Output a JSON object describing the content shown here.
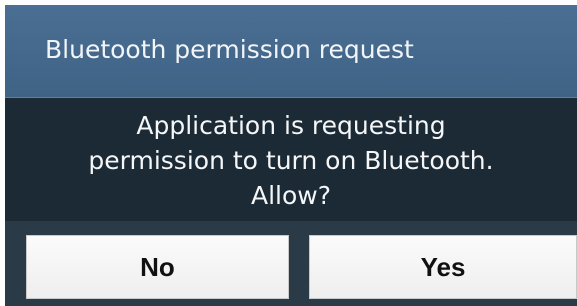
{
  "dialog": {
    "title": "Bluetooth permission request",
    "message_lines": [
      "Application is requesting",
      "permission to turn on Bluetooth.",
      "Allow?"
    ],
    "buttons": {
      "no_label": "No",
      "yes_label": "Yes"
    }
  },
  "colors": {
    "title_bar": "#46698c",
    "dialog_body": "#1b2a35",
    "button_bar": "#2a3a47",
    "button_face": "#f5f5f5"
  }
}
